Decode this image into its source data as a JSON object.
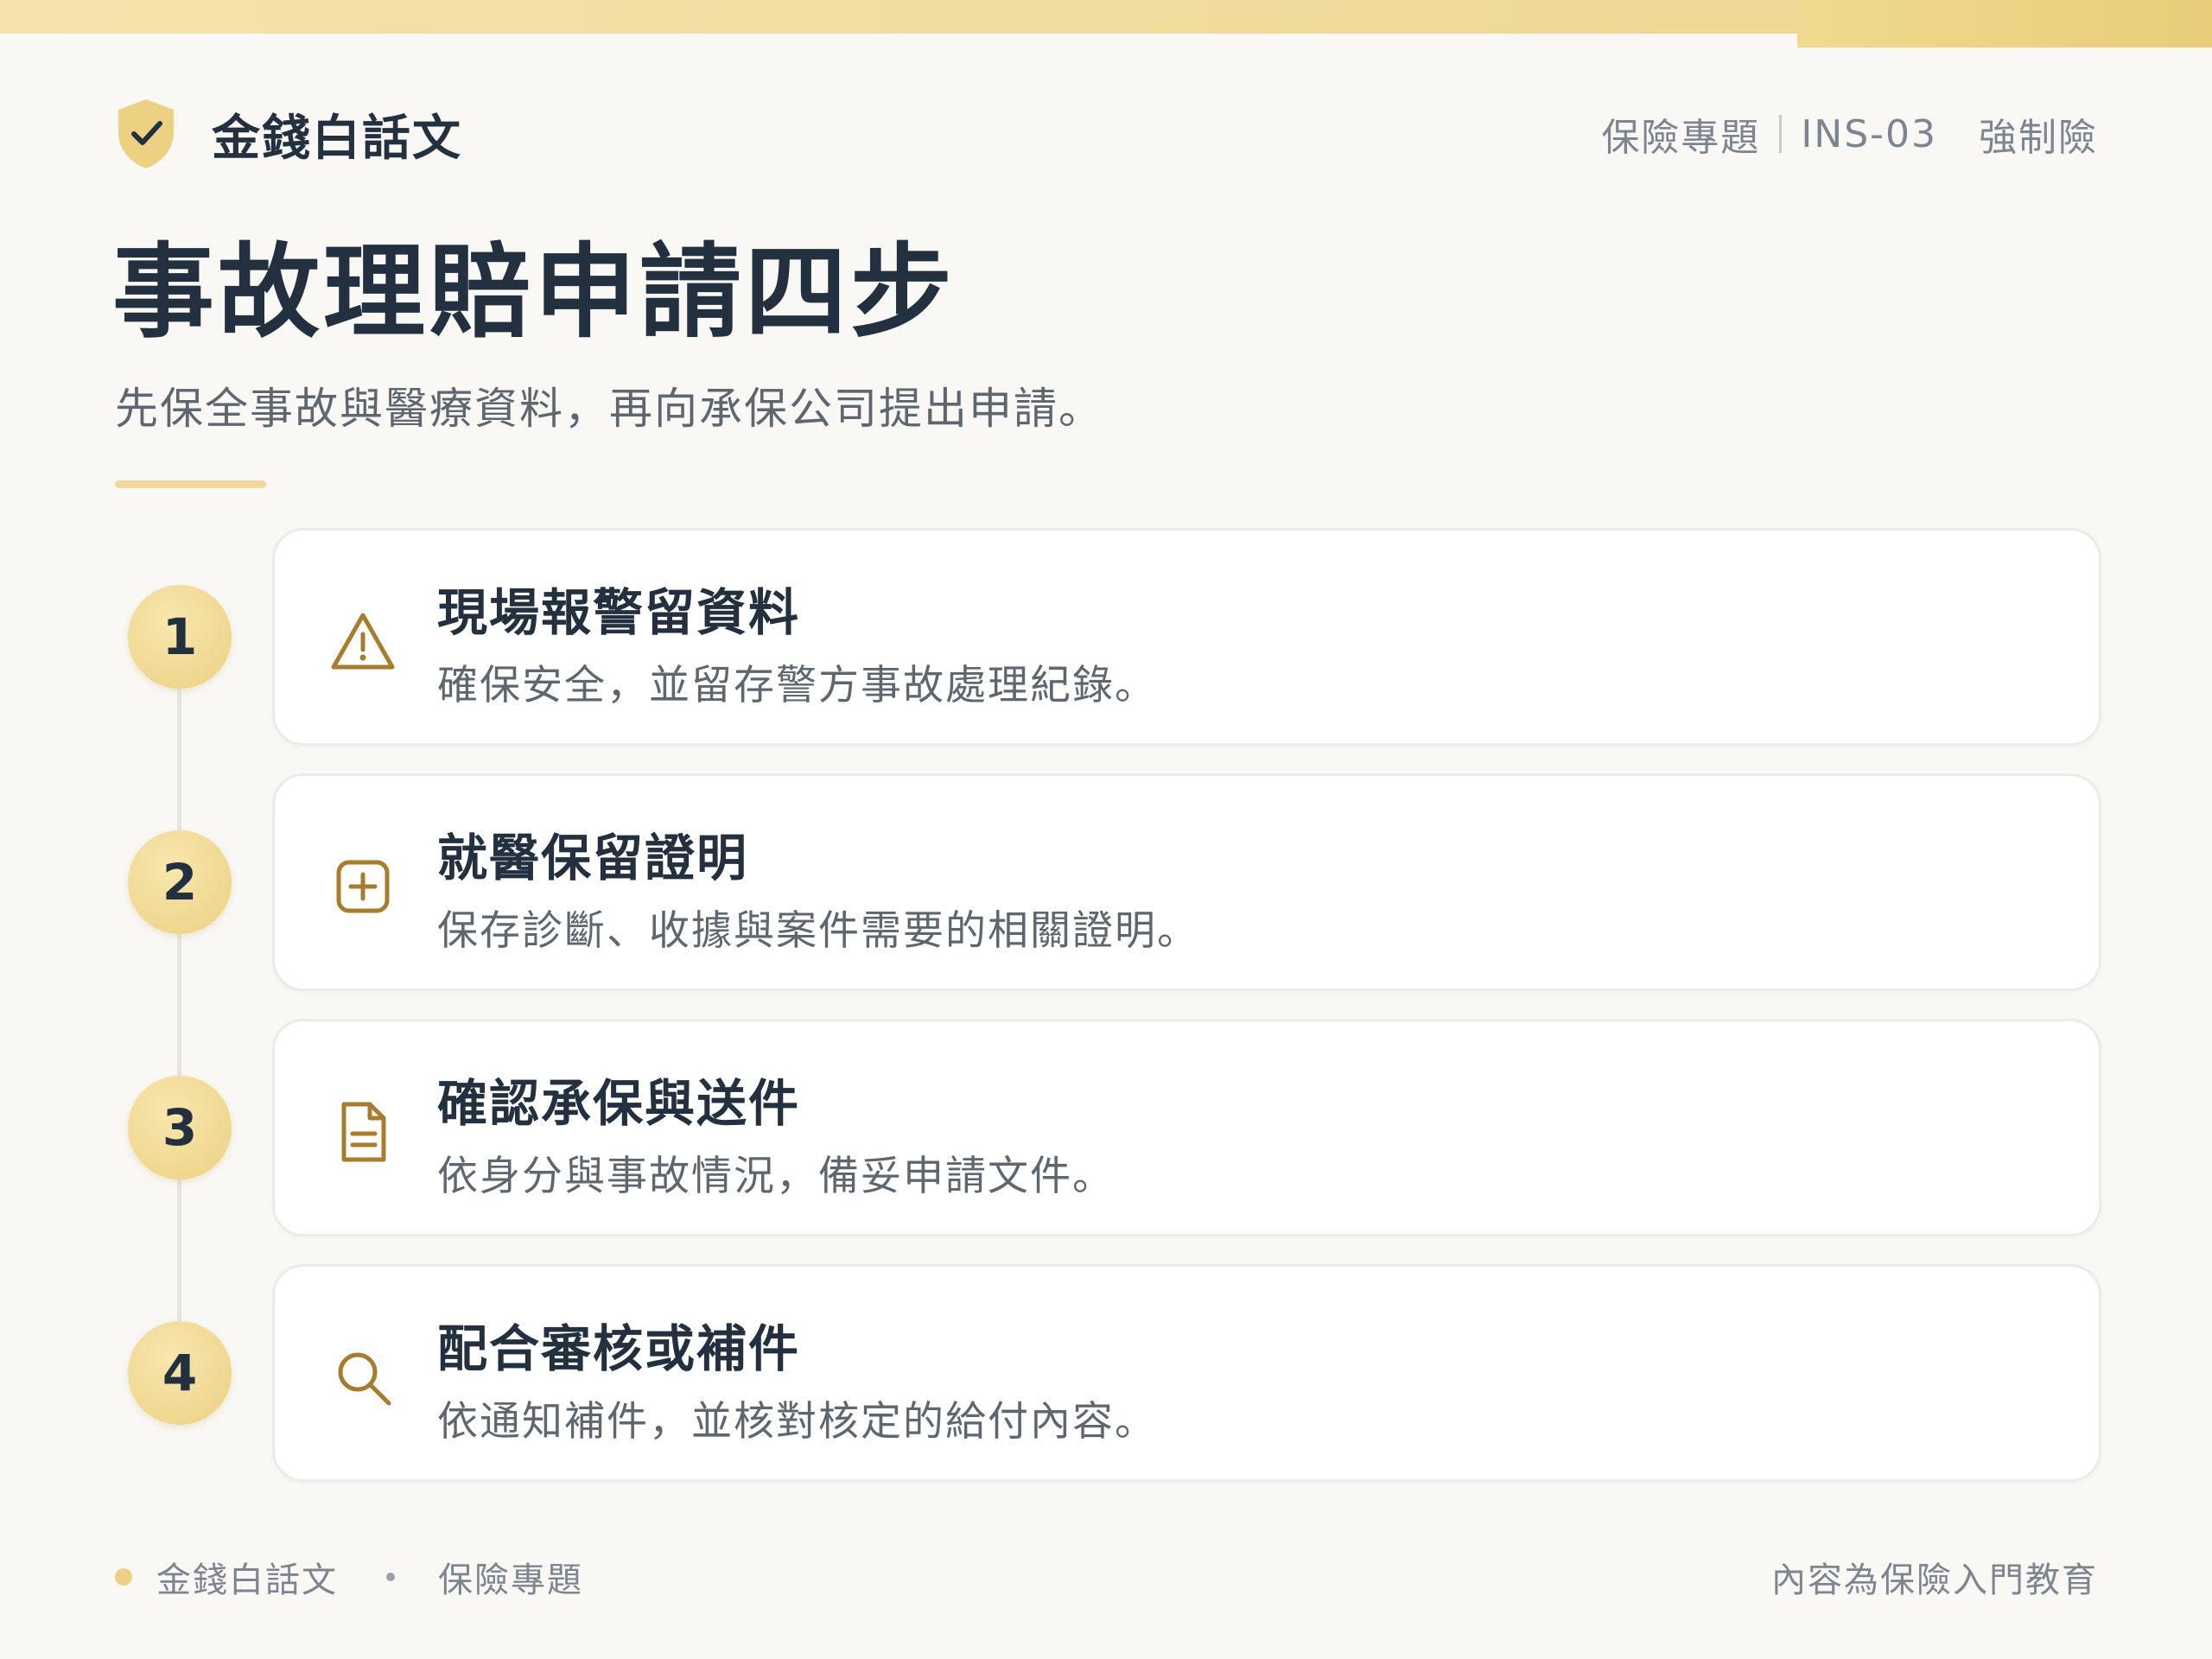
{
  "header": {
    "brand": "金錢白話文",
    "category": "保險專題",
    "code": "INS-03",
    "tag": "強制險"
  },
  "title": "事故理賠申請四步",
  "subtitle": "先保全事故與醫療資料，再向承保公司提出申請。",
  "steps": [
    {
      "number": "1",
      "icon": "warning-triangle-icon",
      "title": "現場報警留資料",
      "description": "確保安全，並留存警方事故處理紀錄。"
    },
    {
      "number": "2",
      "icon": "medical-plus-icon",
      "title": "就醫保留證明",
      "description": "保存診斷、收據與案件需要的相關證明。"
    },
    {
      "number": "3",
      "icon": "document-icon",
      "title": "確認承保與送件",
      "description": "依身分與事故情況，備妥申請文件。"
    },
    {
      "number": "4",
      "icon": "search-icon",
      "title": "配合審核或補件",
      "description": "依通知補件，並核對核定的給付內容。"
    }
  ],
  "footer": {
    "brand": "金錢白話文",
    "category": "保險專題",
    "note": "內容為保險入門教育"
  },
  "colors": {
    "accent": "#ecd183",
    "icon": "#a77c2c",
    "text": "#22303f",
    "muted": "#5e6770",
    "background": "#f9f8f5"
  }
}
